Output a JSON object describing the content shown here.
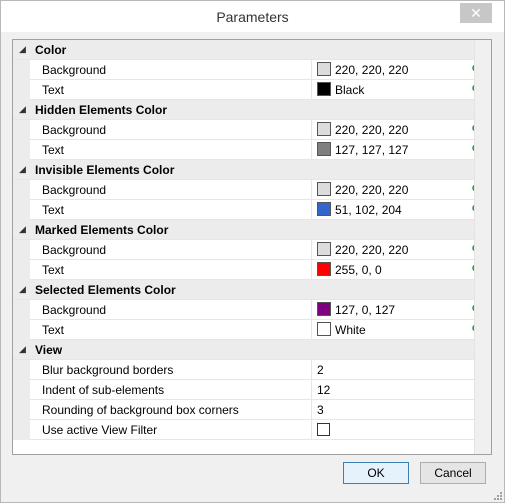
{
  "window": {
    "title": "Parameters",
    "close_glyph": "✕"
  },
  "categories": [
    {
      "label": "Color",
      "props": [
        {
          "name": "Background",
          "swatch": "#dcdcdc",
          "value": "220, 220, 220"
        },
        {
          "name": "Text",
          "swatch": "#000000",
          "value": "Black"
        }
      ]
    },
    {
      "label": "Hidden Elements Color",
      "props": [
        {
          "name": "Background",
          "swatch": "#dcdcdc",
          "value": "220, 220, 220"
        },
        {
          "name": "Text",
          "swatch": "#7f7f7f",
          "value": "127, 127, 127"
        }
      ]
    },
    {
      "label": "Invisible Elements Color",
      "props": [
        {
          "name": "Background",
          "swatch": "#dcdcdc",
          "value": "220, 220, 220"
        },
        {
          "name": "Text",
          "swatch": "#3366cc",
          "value": "51, 102, 204"
        }
      ]
    },
    {
      "label": "Marked Elements Color",
      "props": [
        {
          "name": "Background",
          "swatch": "#dcdcdc",
          "value": "220, 220, 220"
        },
        {
          "name": "Text",
          "swatch": "#ff0000",
          "value": "255, 0, 0"
        }
      ]
    },
    {
      "label": "Selected Elements Color",
      "props": [
        {
          "name": "Background",
          "swatch": "#7f007f",
          "value": "127, 0, 127"
        },
        {
          "name": "Text",
          "swatch": "#ffffff",
          "value": "White"
        }
      ]
    }
  ],
  "view": {
    "label": "View",
    "props": [
      {
        "name": "Blur background borders",
        "value": "2"
      },
      {
        "name": "Indent of sub-elements",
        "value": "12"
      },
      {
        "name": "Rounding of background box corners",
        "value": "3"
      },
      {
        "name": "Use active View Filter",
        "checked": false
      }
    ]
  },
  "icons": {
    "expanded_arrow": "◢",
    "palette": "color-palette-icon"
  },
  "buttons": {
    "ok": "OK",
    "cancel": "Cancel"
  }
}
